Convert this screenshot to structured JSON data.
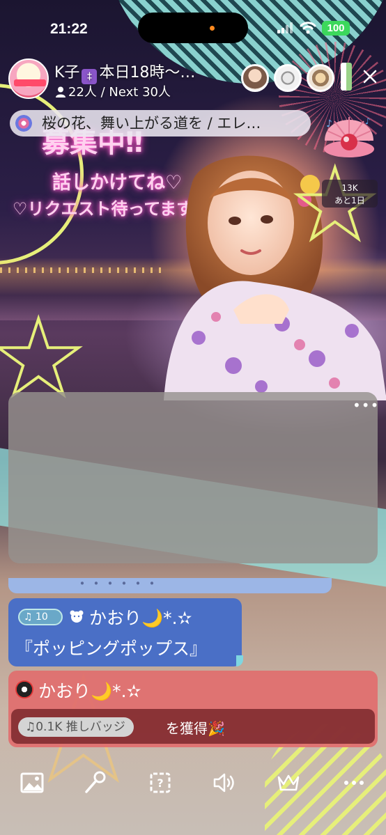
{
  "status_bar": {
    "time": "21:22",
    "battery": "100"
  },
  "header": {
    "host_name": "K子",
    "host_badge_glyph": "‡",
    "host_title": "本日18時〜…",
    "viewer_count": "22人 / Next 30人"
  },
  "now_playing": {
    "text": "桜の花、舞い上がる道を / エレ…"
  },
  "event_badge": {
    "count": "13K",
    "remaining": "あと1日"
  },
  "stream": {
    "banner_line1": "募集中‼",
    "banner_line2": "話しかけてね♡",
    "banner_line3": "♡リクエスト待ってます"
  },
  "video_card": {
    "more_label": "•••"
  },
  "chat": {
    "messages": [
      {
        "type": "song_request",
        "badge_label": "♫ 10",
        "user": "かおり🌙*.✫",
        "text": "『ポッピングポップス』"
      },
      {
        "type": "badge_acquired",
        "user": "かおり🌙*.✫",
        "badge_label": "♫0.1K 推しバッジ",
        "text": "を獲得🎉"
      }
    ]
  },
  "toolbar": {
    "items": [
      "image-icon",
      "microphone-icon",
      "question-icon",
      "speaker-icon",
      "crown-icon",
      "more-icon"
    ]
  },
  "colors": {
    "accent_teal": "#8fdbd6",
    "accent_yellow": "#e6ef7a",
    "chat_blue": "#4a6fc6",
    "chat_red": "#e16e6e",
    "battery_green": "#3cd85c"
  }
}
